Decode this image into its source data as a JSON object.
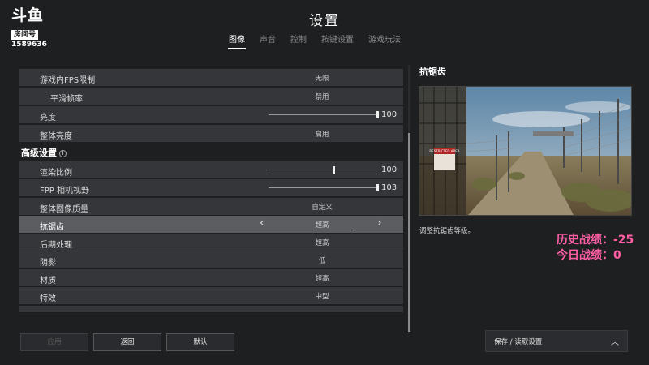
{
  "logo": {
    "brand": "斗鱼",
    "room_label": "房间号",
    "room_number": "1589636"
  },
  "title": "设置",
  "tabs": [
    {
      "label": "图像",
      "active": true
    },
    {
      "label": "声音",
      "active": false
    },
    {
      "label": "控制",
      "active": false
    },
    {
      "label": "按键设置",
      "active": false
    },
    {
      "label": "游戏玩法",
      "active": false
    }
  ],
  "rows_top": [
    {
      "label": "游戏内FPS限制",
      "value": "无限",
      "type": "value",
      "indent": false
    },
    {
      "label": "平滑帧率",
      "value": "禁用",
      "type": "value",
      "indent": true
    },
    {
      "label": "亮度",
      "value": "100",
      "type": "slider",
      "level": 1.0,
      "indent": false
    },
    {
      "label": "整体亮度",
      "value": "启用",
      "type": "value",
      "indent": false
    }
  ],
  "section": {
    "title": "高级设置"
  },
  "rows_advanced": [
    {
      "label": "渲染比例",
      "value": "100",
      "type": "slider",
      "level": 0.6
    },
    {
      "label": "FPP 相机视野",
      "value": "103",
      "type": "slider",
      "level": 1.0
    },
    {
      "label": "整体图像质量",
      "value": "自定义",
      "type": "value"
    },
    {
      "label": "抗锯齿",
      "value": "超高",
      "type": "selector",
      "selected": true
    },
    {
      "label": "后期处理",
      "value": "超高",
      "type": "value"
    },
    {
      "label": "阴影",
      "value": "低",
      "type": "value"
    },
    {
      "label": "材质",
      "value": "超高",
      "type": "value"
    },
    {
      "label": "特效",
      "value": "中型",
      "type": "value"
    }
  ],
  "detail": {
    "title": "抗锯齿",
    "description": "调整抗锯齿等级。",
    "sign_text": "RESTRICTED AREA"
  },
  "stats": {
    "history": "历史战绩：-25",
    "today": "今日战绩：0"
  },
  "buttons": {
    "apply": "应用",
    "back": "返回",
    "default": "默认",
    "save_load": "保存 / 读取设置"
  },
  "colors": {
    "stats": "#ff5ea5",
    "background": "#1e1f21",
    "row": "#34363a",
    "row_selected": "#5b5d61"
  }
}
